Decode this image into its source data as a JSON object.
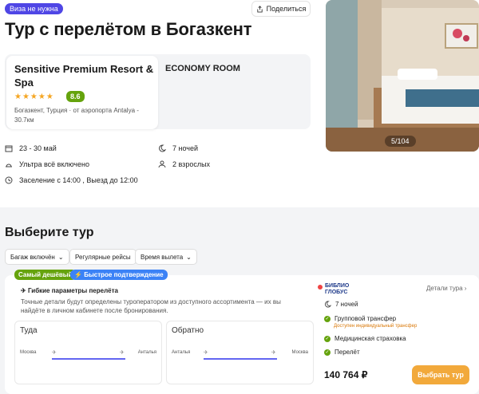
{
  "badge": "Виза не нужна",
  "share_label": "Поделиться",
  "title": "Тур с перелётом в Богазкент",
  "hotel": {
    "name": "Sensitive Premium Resort & Spa",
    "rating": "8.6",
    "stars": "★★★★★",
    "location": "Богазкент, Турция · от аэропорта Antalya - 30.7км"
  },
  "room_type": "ECONOMY ROOM",
  "photo_counter": "5/104",
  "info": {
    "dates": "23 - 30 май",
    "nights": "7 ночей",
    "meals": "Ультра всё включено",
    "guests": "2 взрослых",
    "checkin": "Заселение с 14:00 , Выезд до 12:00"
  },
  "choose_title": "Выберите тур",
  "filters": [
    "Багаж включён",
    "Регулярные рейсы",
    "Время вылета"
  ],
  "offer": {
    "tag_cheapest": "Самый дешёвый",
    "tag_fast": "Быстрое подтверждение",
    "flex_title": "Гибкие параметры перелёта",
    "flex_desc": "Точные детали будут определены туроператором из доступного ассортимента — их вы найдёте в личном кабинете после бронирования.",
    "outbound": {
      "label": "Туда",
      "from": "Москва",
      "to": "Анталья"
    },
    "return": {
      "label": "Обратно",
      "from": "Анталья",
      "to": "Москва"
    },
    "operator_logo": "БИБЛИО ГЛОБУС",
    "details_label": "Детали тура ›",
    "nights": "7 ночей",
    "features": [
      "Групповой трансфер",
      "Медицинская страховка",
      "Перелёт"
    ],
    "transfer_note": "Доступен индивидуальный трансфер",
    "price": "140 764 ₽",
    "buy_label": "Выбрать тур"
  }
}
